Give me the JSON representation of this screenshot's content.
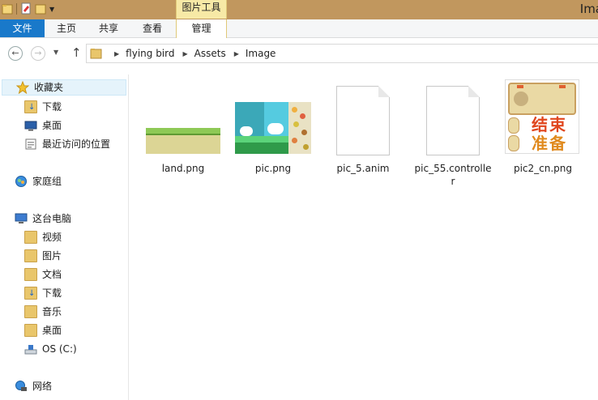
{
  "window": {
    "title": "Ima",
    "contextual_tab_group": "图片工具"
  },
  "ribbon": {
    "tabs": [
      {
        "id": "file",
        "label": "文件"
      },
      {
        "id": "home",
        "label": "主页"
      },
      {
        "id": "share",
        "label": "共享"
      },
      {
        "id": "view",
        "label": "查看"
      },
      {
        "id": "manage",
        "label": "管理"
      }
    ]
  },
  "address": {
    "breadcrumbs": [
      "flying bird",
      "Assets",
      "Image"
    ]
  },
  "sidebar": {
    "favorites": {
      "label": "收藏夹",
      "items": [
        "下载",
        "桌面",
        "最近访问的位置"
      ]
    },
    "homegroup": {
      "label": "家庭组"
    },
    "this_pc": {
      "label": "这台电脑",
      "items": [
        "视频",
        "图片",
        "文档",
        "下载",
        "音乐",
        "桌面",
        "OS (C:)"
      ]
    },
    "network": {
      "label": "网络"
    }
  },
  "files": [
    {
      "name": "land.png",
      "icon": "land-thumbnail"
    },
    {
      "name": "pic.png",
      "icon": "sprite-sheet-thumbnail"
    },
    {
      "name": "pic_5.anim",
      "icon": "blank-document-icon"
    },
    {
      "name_line1": "pic_55.controlle",
      "name_line2": "r",
      "icon": "blank-document-icon"
    },
    {
      "name": "pic2_cn.png",
      "icon": "game-ui-thumbnail",
      "thumbnail_text": [
        "结束",
        "准备"
      ]
    }
  ],
  "colors": {
    "titlebar": "#c1975e",
    "file_tab": "#1979ca",
    "contextual_tab": "#f7e9a6",
    "selected_nav": "#e5f3fb"
  }
}
